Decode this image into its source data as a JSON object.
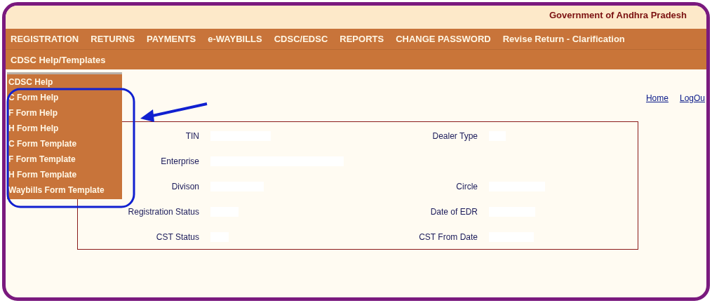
{
  "header": {
    "title": "Government of Andhra Pradesh"
  },
  "menu": [
    {
      "label": "REGISTRATION"
    },
    {
      "label": "RETURNS"
    },
    {
      "label": "PAYMENTS"
    },
    {
      "label": "e-WAYBILLS"
    },
    {
      "label": "CDSC/EDSC"
    },
    {
      "label": "REPORTS"
    },
    {
      "label": "CHANGE PASSWORD"
    },
    {
      "label": "Revise Return - Clarification"
    }
  ],
  "submenu": [
    {
      "label": "CDSC Help/Templates"
    }
  ],
  "dropdown": [
    {
      "label": "CDSC Help"
    },
    {
      "label": "C Form Help"
    },
    {
      "label": "F Form Help"
    },
    {
      "label": "H Form Help"
    },
    {
      "label": "C Form Template"
    },
    {
      "label": "F Form Template"
    },
    {
      "label": "H Form Template"
    },
    {
      "label": "Waybills Form Template"
    }
  ],
  "links": [
    {
      "label": "Home"
    },
    {
      "label": "LogOu"
    }
  ],
  "details": [
    {
      "left": "TIN",
      "right": "Dealer Type"
    },
    {
      "left": "Enterprise"
    },
    {
      "left": "Divison",
      "right": "Circle"
    },
    {
      "left": "Registration Status",
      "right": "Date of EDR"
    },
    {
      "left": "CST Status",
      "right": "CST From Date"
    }
  ]
}
